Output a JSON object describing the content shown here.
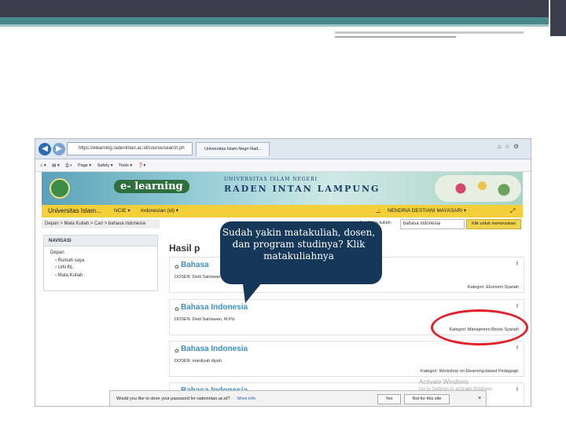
{
  "browser": {
    "url": "https://elearning.radenintan.ac.id/course/search.ph",
    "tab_title": "Universitas Islam Negri Rad...",
    "tab_close": "×",
    "command_bar": [
      "Page ▾",
      "Safety ▾",
      "Tools ▾"
    ]
  },
  "banner": {
    "elearning": "e- learning",
    "univ": "UNIVERSITAS ISLAM NEGERI",
    "raden": "RADEN INTAN LAMPUNG"
  },
  "navbar": {
    "brand": "Universitas Islam...",
    "ncie": "NCIE ▾",
    "language": "Indonesian (id) ▾",
    "user": "NENDRIA DESTIANI MAYASARI ▾"
  },
  "breadcrumb": "Depan > Mata Kuliah > Cari > bahasa indonesia",
  "search": {
    "label": "Cari Mata kuliah:",
    "value": "bahasa indonesia",
    "button": "Klik untuk meneruskan"
  },
  "nav_panel": {
    "heading": "NAVIGASI",
    "root": "Depan",
    "items": [
      "Rumah saya",
      "UIN RL",
      "Mata Kuliah"
    ]
  },
  "results_title": "Hasil p",
  "courses": [
    {
      "title": "Bahasa",
      "dosen": "DOSEN: Dedi Satriawan...",
      "kategori": "Kategori: Ekonomi Syariah"
    },
    {
      "title": "Bahasa Indonesia",
      "dosen": "DOSEN: Dedi Satriawan, M.Pd.",
      "kategori": "Kategori: Manajemen Bisnis Syariah"
    },
    {
      "title": "Bahasa Indonesia",
      "dosen": "DOSEN: mardiyah diyah",
      "kategori": "Kategori: Workshop on Elearning-based Pedagogic"
    },
    {
      "title": "Bahasa Indonesia",
      "dosen": "",
      "kategori": ""
    }
  ],
  "watermark": {
    "title": "Activate Windows",
    "sub": "Go to Settings to activate Windows."
  },
  "password_bar": {
    "message": "Would you like to store your password for radenintan.ac.id?",
    "more": "More info",
    "yes": "Yes",
    "not_for_site": "Not for this site",
    "close": "×"
  },
  "callout": {
    "text": "Sudah yakin matakuliah, dosen, dan program studinya? Klik matakuliahnya"
  },
  "colors": {
    "callout_bg": "#163858",
    "highlight_ring": "#e0202a",
    "navbar": "#f3cf3a",
    "course_title": "#3e8fc4"
  }
}
